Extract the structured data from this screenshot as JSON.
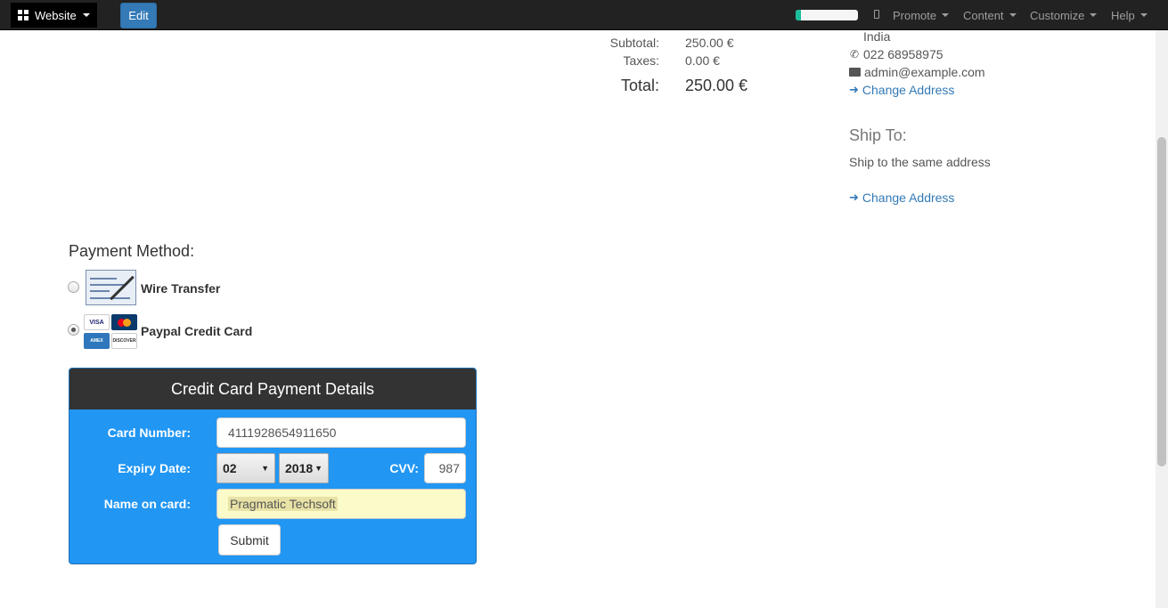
{
  "topbar": {
    "website_label": "Website",
    "edit_label": "Edit",
    "progress": 0.08,
    "menus": [
      "Promote",
      "Content",
      "Customize",
      "Help"
    ]
  },
  "summary": {
    "subtotal_label": "Subtotal:",
    "subtotal_value": "250.00 €",
    "taxes_label": "Taxes:",
    "taxes_value": "0.00 €",
    "total_label": "Total:",
    "total_value": "250.00 €"
  },
  "billing": {
    "country": "India",
    "phone": "022 68958975",
    "email": "admin@example.com",
    "change_address": "Change Address"
  },
  "shipping": {
    "title": "Ship To:",
    "text": "Ship to the same address",
    "change_address": "Change Address"
  },
  "payment": {
    "title": "Payment Method:",
    "options": [
      {
        "label": "Wire Transfer",
        "selected": false
      },
      {
        "label": "Paypal Credit Card",
        "selected": true
      }
    ],
    "card_logos": [
      "VISA",
      "MC",
      "AMEX",
      "DISCOVER"
    ]
  },
  "cc_form": {
    "title": "Credit Card Payment Details",
    "card_number_label": "Card Number:",
    "card_number_value": "4111928654911650",
    "expiry_label": "Expiry Date:",
    "expiry_month": "02",
    "expiry_year": "2018",
    "cvv_label": "CVV:",
    "cvv_value": "987",
    "name_label": "Name on card:",
    "name_value": "Pragmatic Techsoft",
    "submit_label": "Submit"
  },
  "colors": {
    "accent": "#337ab7",
    "panel_blue": "#2196f3",
    "panel_header": "#333333",
    "topbar": "#222222"
  }
}
